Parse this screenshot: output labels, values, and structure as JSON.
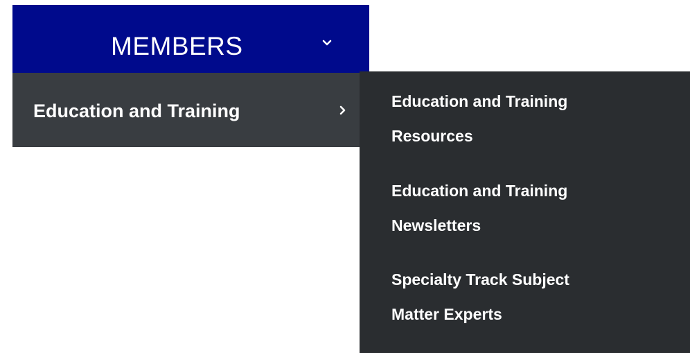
{
  "nav": {
    "top_label": "MEMBERS",
    "top_bg": "#000a8c",
    "menu_bg": "#393d41",
    "submenu_bg": "#2a2d30"
  },
  "menu": {
    "item_label": "Education and Training"
  },
  "submenu": {
    "items": [
      {
        "line1": "Education and Training",
        "line2": "Resources"
      },
      {
        "line1": "Education and Training",
        "line2": "Newsletters"
      },
      {
        "line1": "Specialty Track Subject",
        "line2": "Matter Experts"
      }
    ]
  },
  "icons": {
    "top": "chevron-down-icon",
    "item": "chevron-right-icon"
  }
}
